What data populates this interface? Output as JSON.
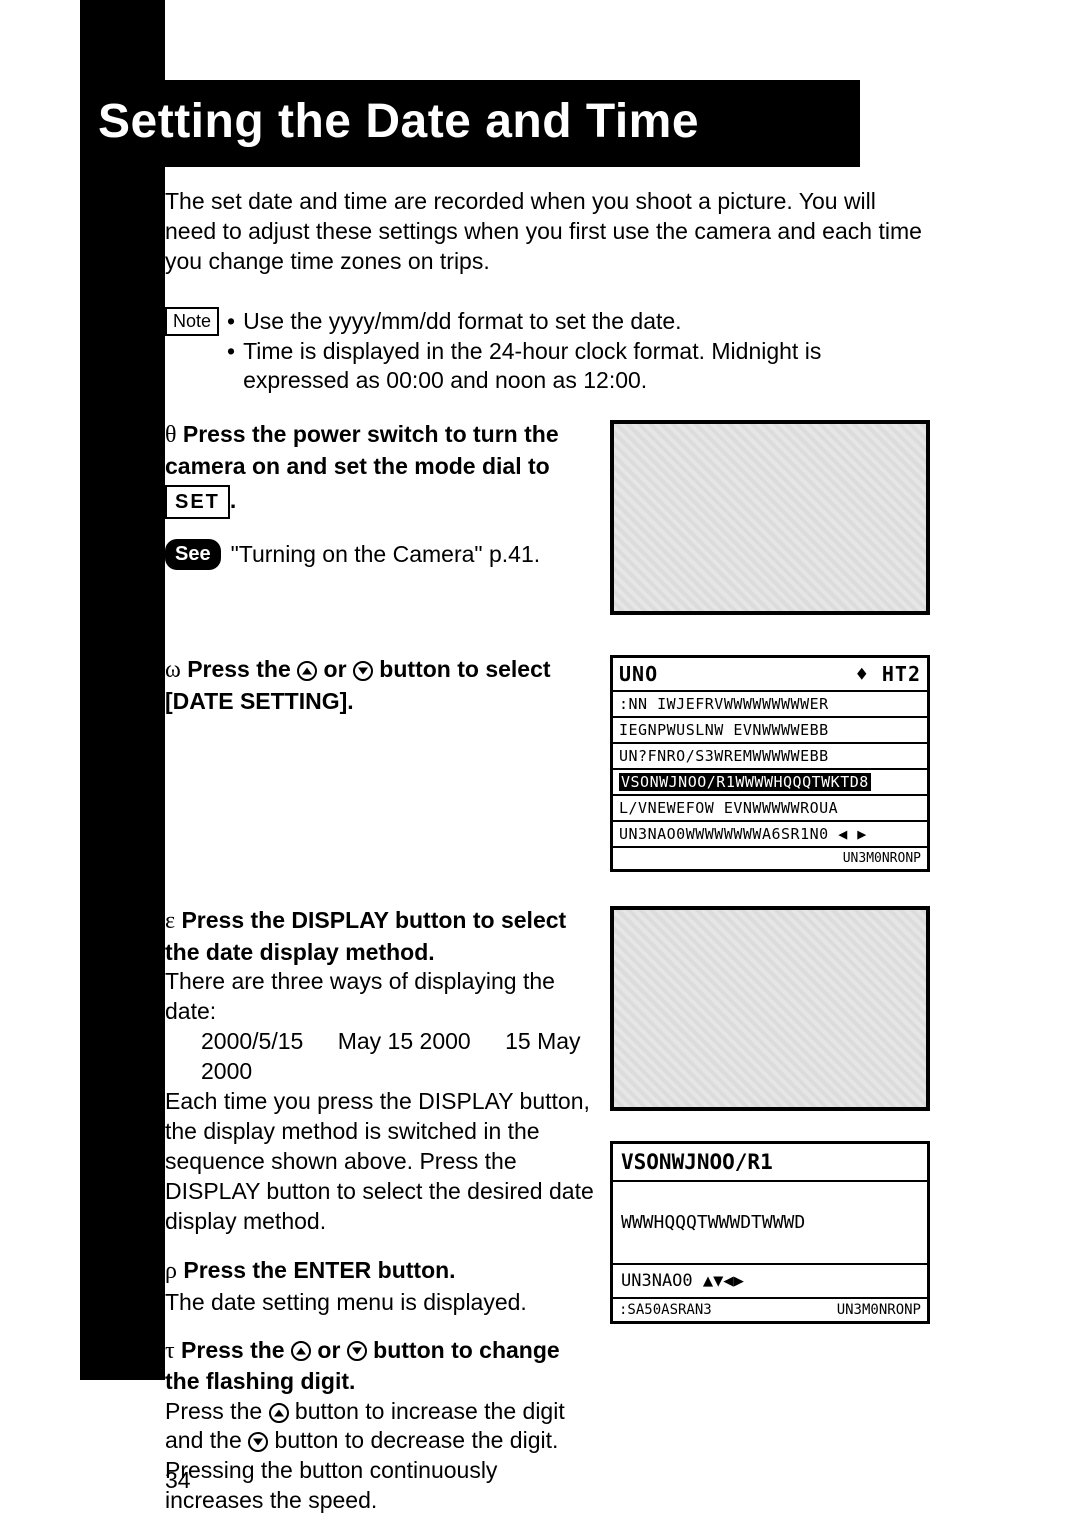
{
  "page_number": "34",
  "title": "Setting the Date and Time",
  "intro": "The set date and time are recorded when you shoot a picture. You will need to adjust these settings when you first use the camera and each time you change time zones on trips.",
  "note_label": "Note",
  "note_bullets": [
    "Use the yyyy/mm/dd format to set the date.",
    "Time is displayed in the 24-hour clock format. Midnight is expressed as 00:00 and noon as 12:00."
  ],
  "see_label": "See",
  "see_text": "\"Turning on the Camera\" p.41.",
  "steps": {
    "s1": {
      "symbol": "θ",
      "head_a": "Press the power switch to turn the camera on and set the mode dial to",
      "set_label": "SET",
      "head_b": "."
    },
    "s2": {
      "symbol": "ω",
      "head_a": "Press the ",
      "head_b": " or ",
      "head_c": " button to select [DATE SETTING]."
    },
    "s3": {
      "symbol": "ε",
      "head": "Press the DISPLAY button to select the date display method.",
      "body_a": "There are three ways of displaying the date:",
      "examples": [
        "2000/5/15",
        "May 15 2000",
        "15 May 2000"
      ],
      "body_b": "Each time you press the DISPLAY button, the display method is switched in the sequence shown above. Press the DISPLAY button to select the desired date display method."
    },
    "s4": {
      "symbol": "ρ",
      "head": "Press the ENTER button.",
      "body": "The date setting menu is displayed."
    },
    "s5": {
      "symbol": "τ",
      "head_a": "Press the ",
      "head_b": " or ",
      "head_c": " button to change the flashing digit.",
      "body_a": "Press the ",
      "body_b": " button to increase the digit and the ",
      "body_c": " button to decrease the digit. Pressing the button continuously increases the speed."
    }
  },
  "lcd1": {
    "head_left": "UNO",
    "head_right_glyph": "♦",
    "head_right": "HT2",
    "rows": [
      ":NN IWJEFRVWWWWWWWWWER",
      "IEGNPWUSLNW EVNWWWWEBB",
      "UN?FNRO/S3WREMWWWWWEBB",
      "VSONWJNOO/R1WWWWHQQQTWKTD8",
      "L/VNEWEFOW EVNWWWWWROUA",
      "UN3NAO0WWWWWWWWA6SR1N0 ◀ ▶"
    ],
    "highlight_row_index": 3,
    "foot": "UN3M0NRONP"
  },
  "lcd2": {
    "title": "VSONWJNOO/R1",
    "body": "WWWHQQQTWWWDTWWWD",
    "row2": "UN3NAO0 ▲▼◀▶",
    "foot_left": ":SA50ASRAN3",
    "foot_right": "UN3M0NRONP"
  }
}
